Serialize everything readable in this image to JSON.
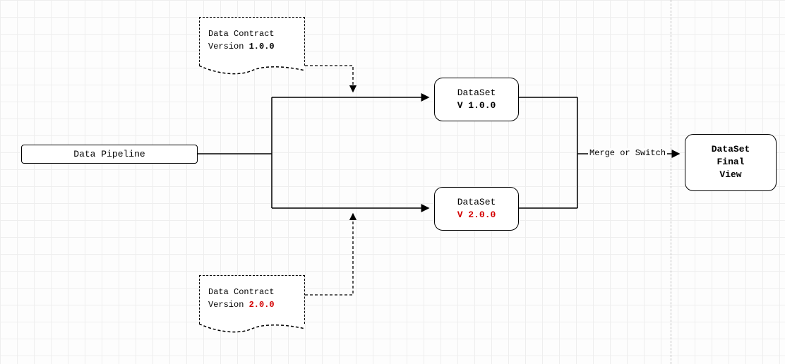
{
  "nodes": {
    "pipeline": {
      "label": "Data Pipeline"
    },
    "contract_v1": {
      "line1": "Data Contract",
      "line2_prefix": "Version ",
      "version": "1.0.0"
    },
    "contract_v2": {
      "line1": "Data Contract",
      "line2_prefix": "Version ",
      "version": "2.0.0"
    },
    "dataset_v1": {
      "line1": "DataSet",
      "line2": "V 1.0.0"
    },
    "dataset_v2": {
      "line1": "DataSet",
      "line2": "V 2.0.0"
    },
    "final": {
      "line1": "DataSet Final",
      "line2": "View"
    }
  },
  "edges": {
    "merge_label": "Merge or Switch"
  },
  "colors": {
    "highlight": "#d40000"
  }
}
